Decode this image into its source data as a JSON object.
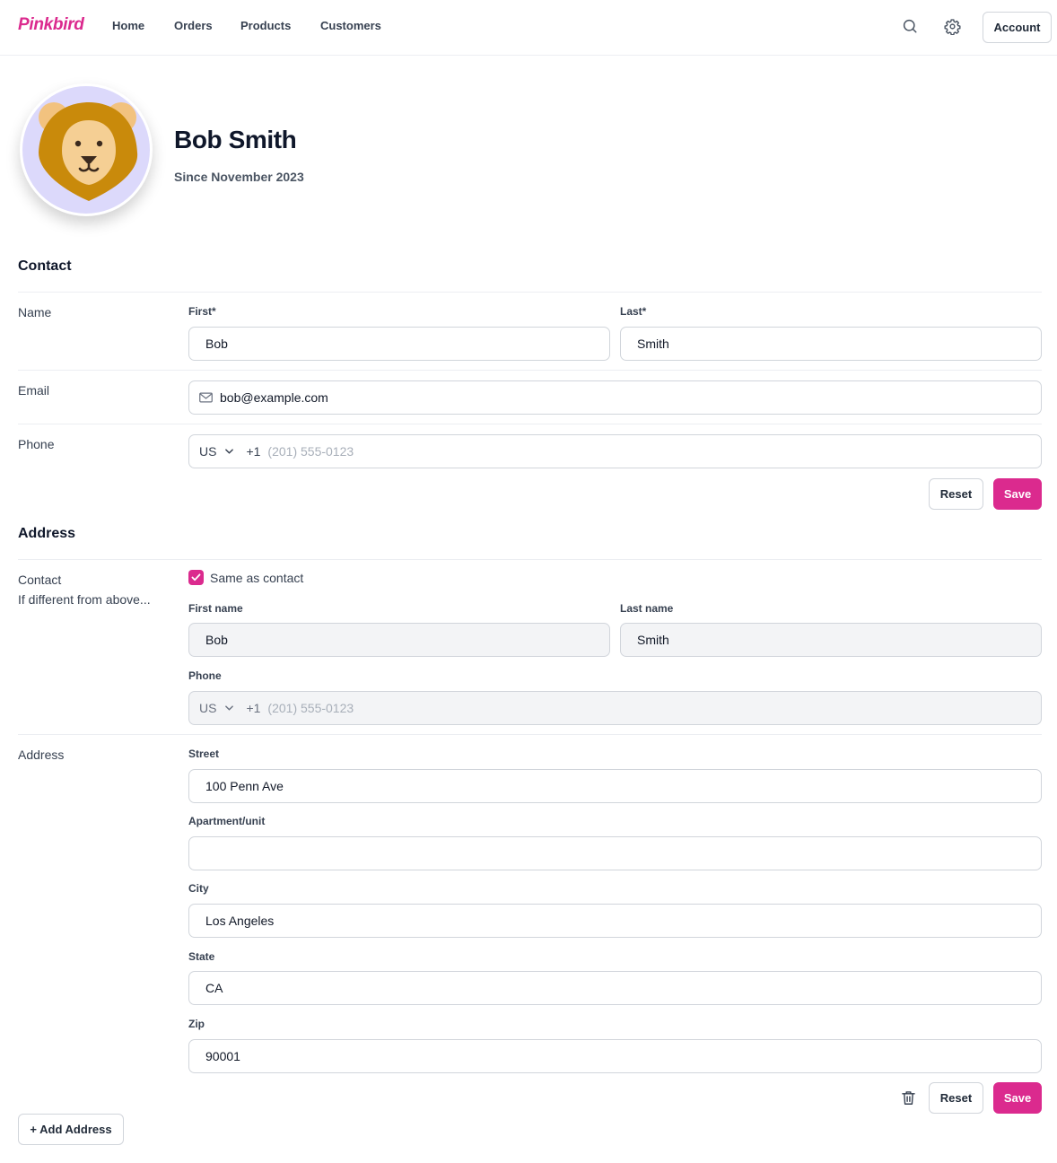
{
  "nav": {
    "brand": "Pinkbird",
    "links": [
      "Home",
      "Orders",
      "Products",
      "Customers"
    ],
    "icons": [
      "search-icon",
      "gear-icon"
    ],
    "account_label": "Account"
  },
  "profile": {
    "name": "Bob Smith",
    "since": "Since November 2023",
    "avatar_icon": "lion-avatar-icon"
  },
  "contact": {
    "section_title": "Contact",
    "name_label": "Name",
    "first_label": "First*",
    "first_value": "Bob",
    "last_label": "Last*",
    "last_value": "Smith",
    "email_label": "Email",
    "email_value": "bob@example.com",
    "phone_label": "Phone",
    "phone_country": "US",
    "phone_dial": "+1",
    "phone_placeholder": "(201) 555-0123",
    "reset_label": "Reset",
    "save_label": "Save"
  },
  "address_section": {
    "section_title": "Address",
    "contact_label": "Contact",
    "contact_sublabel": "If different from above...",
    "same_as_contact_label": "Same as contact",
    "same_as_contact_checked": true,
    "first_name_label": "First name",
    "first_name_value": "Bob",
    "last_name_label": "Last name",
    "last_name_value": "Smith",
    "phone_label": "Phone",
    "phone_country": "US",
    "phone_dial": "+1",
    "phone_placeholder": "(201) 555-0123",
    "address_label": "Address",
    "street_label": "Street",
    "street_value": "100 Penn Ave",
    "apartment_label": "Apartment/unit",
    "apartment_value": "",
    "city_label": "City",
    "city_value": "Los Angeles",
    "state_label": "State",
    "state_value": "CA",
    "zip_label": "Zip",
    "zip_value": "90001",
    "reset_label": "Reset",
    "save_label": "Save",
    "add_address_label": "+ Add Address"
  },
  "colors": {
    "accent": "#db2a8e",
    "avatar_bg": "#dcd9fb",
    "disabled_field": "#f3f4f6"
  }
}
